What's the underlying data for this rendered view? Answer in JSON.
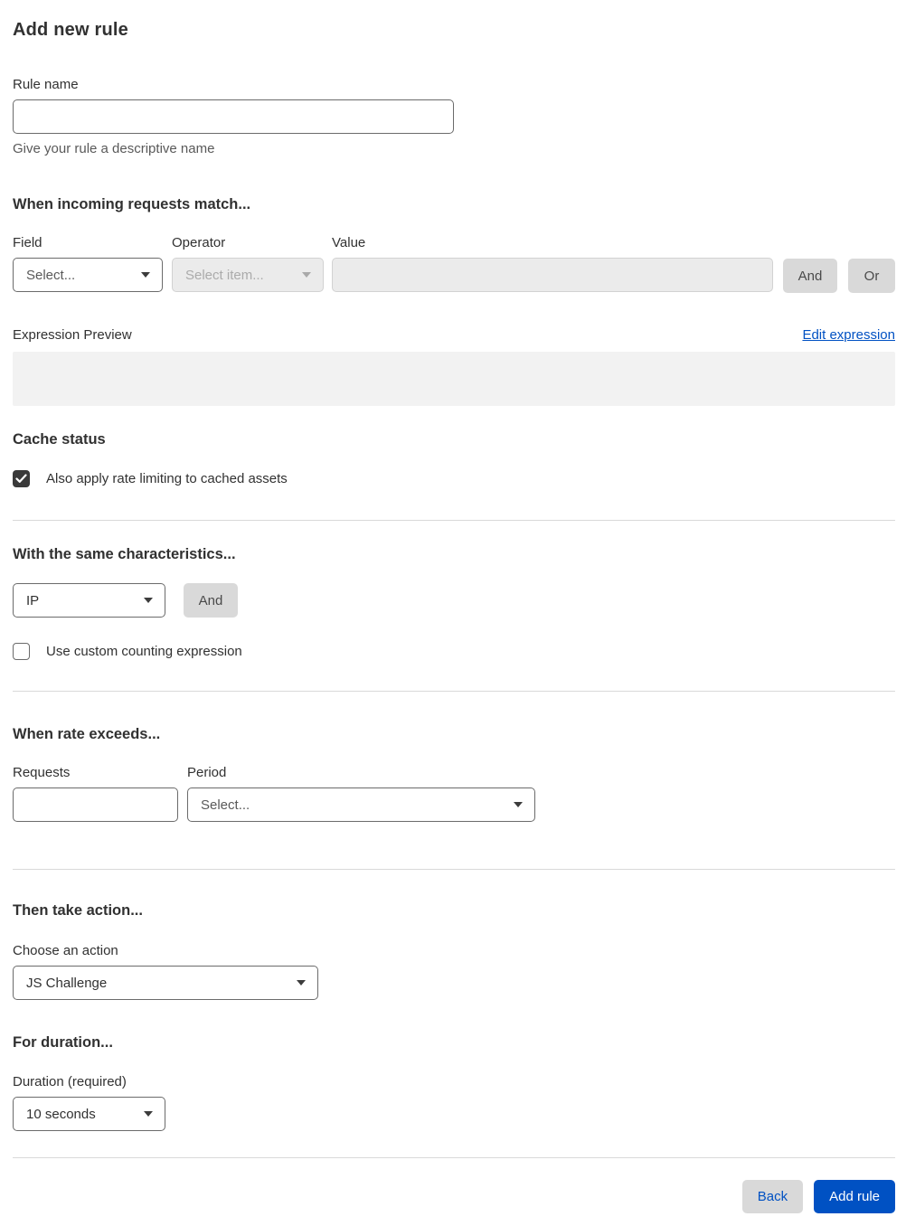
{
  "page": {
    "title": "Add new rule"
  },
  "rule_name": {
    "label": "Rule name",
    "value": "",
    "helper": "Give your rule a descriptive name"
  },
  "match": {
    "heading": "When incoming requests match...",
    "field": {
      "label": "Field",
      "value": "Select..."
    },
    "operator": {
      "label": "Operator",
      "value": "Select item...",
      "disabled": true
    },
    "value": {
      "label": "Value",
      "value": "",
      "disabled": true
    },
    "and_label": "And",
    "or_label": "Or"
  },
  "expression": {
    "label": "Expression Preview",
    "edit_link": "Edit expression",
    "value": ""
  },
  "cache": {
    "heading": "Cache status",
    "checkbox_label": "Also apply rate limiting to cached assets",
    "checked": true
  },
  "characteristics": {
    "heading": "With the same characteristics...",
    "key_value": "IP",
    "and_label": "And",
    "custom_label": "Use custom counting expression",
    "custom_checked": false
  },
  "rate": {
    "heading": "When rate exceeds...",
    "requests": {
      "label": "Requests",
      "value": ""
    },
    "period": {
      "label": "Period",
      "value": "Select..."
    }
  },
  "action": {
    "heading": "Then take action...",
    "label": "Choose an action",
    "value": "JS Challenge"
  },
  "duration": {
    "heading": "For duration...",
    "label": "Duration (required)",
    "value": "10 seconds"
  },
  "footer": {
    "back_label": "Back",
    "add_rule_label": "Add rule"
  },
  "colors": {
    "accent_blue": "#0051c3",
    "heading_text": "#313131",
    "disabled_bg": "#ebebeb",
    "gray_button": "#d9d9d9",
    "divider": "#d9d9d9",
    "preview_box": "#f2f2f2",
    "checkbox_checked": "#3a3a3a"
  }
}
